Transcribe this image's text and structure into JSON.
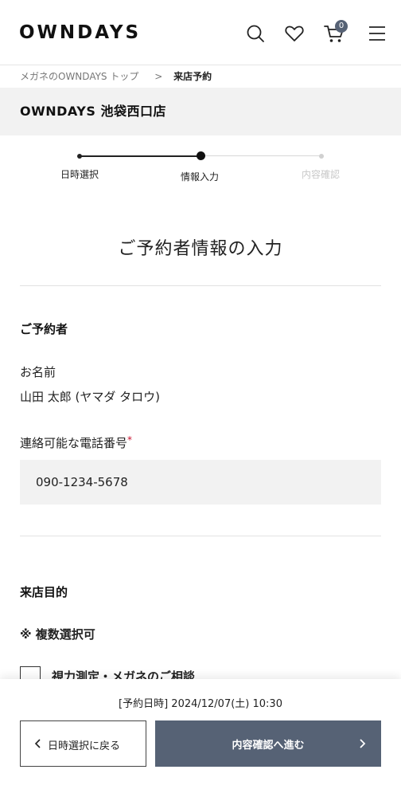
{
  "header": {
    "logo": "OWNDAYS",
    "cart_count": "0",
    "icons": [
      "search-icon",
      "heart-icon",
      "cart-icon",
      "menu-icon"
    ]
  },
  "breadcrumb": {
    "home": "メガネのOWNDAYS トップ",
    "separator": ">",
    "current": "来店予約"
  },
  "store": {
    "name": "OWNDAYS 池袋西口店"
  },
  "steps": [
    {
      "label": "日時選択",
      "state": "done"
    },
    {
      "label": "情報入力",
      "state": "current"
    },
    {
      "label": "内容確認",
      "state": "upcoming"
    }
  ],
  "page_title": "ご予約者情報の入力",
  "reserver": {
    "heading": "ご予約者",
    "name_label": "お名前",
    "name_value": "山田 太郎 (ヤマダ タロウ)",
    "phone_label": "連絡可能な電話番号",
    "required_mark": "*",
    "phone_value": "090-1234-5678"
  },
  "purpose": {
    "heading": "来店目的",
    "note": "※ 複数選択可",
    "options": [
      {
        "label": "視力測定・メガネのご相談",
        "checked": false
      }
    ]
  },
  "footer": {
    "reservation_datetime": "[予約日時] 2024/12/07(土) 10:30",
    "back_label": "日時選択に戻る",
    "next_label": "内容確認へ進む"
  },
  "colors": {
    "accent": "#566275",
    "required": "#c8102e",
    "muted_step": "#c8c8c8",
    "panel_bg": "#f2f2f2"
  }
}
